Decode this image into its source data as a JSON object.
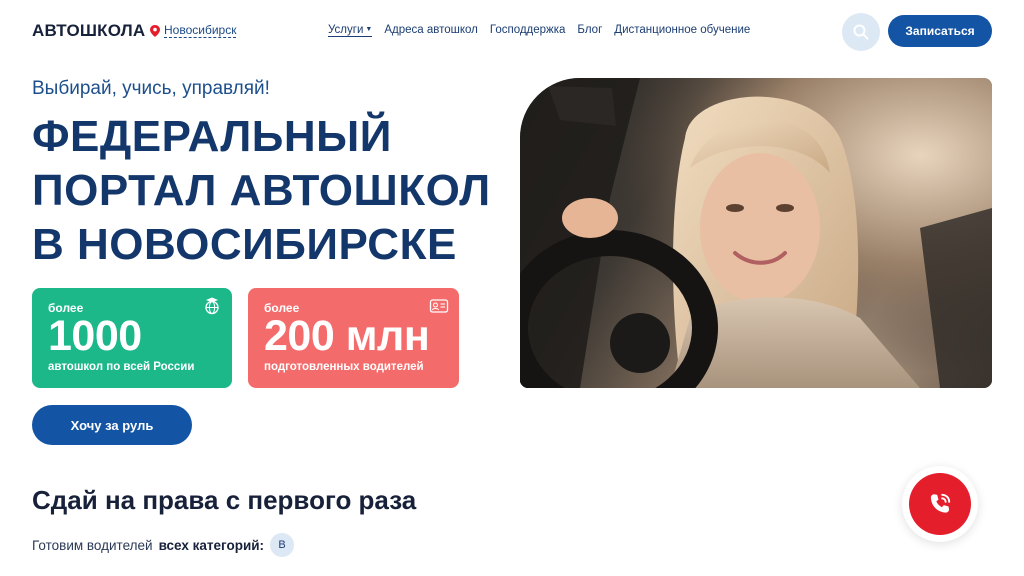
{
  "header": {
    "logo": "АВТОШКОЛА",
    "city": "Новосибирск",
    "nav": [
      {
        "label": "Услуги"
      },
      {
        "label": "Адреса автошкол"
      },
      {
        "label": "Господдержка"
      },
      {
        "label": "Блог"
      },
      {
        "label": "Дистанционное обучение"
      }
    ],
    "signup_label": "Записаться"
  },
  "hero": {
    "slogan": "Выбирай, учись, управляй!",
    "title_lines": [
      "ФЕДЕРАЛЬНЫЙ",
      "ПОРТАЛ АВТОШКОЛ",
      "В НОВОСИБИРСКЕ"
    ],
    "stats": [
      {
        "pre": "более",
        "value": "1000",
        "caption": "автошкол по всей России",
        "color": "#1db88a"
      },
      {
        "pre": "более",
        "value": "200 млн",
        "caption": "подготовленных водителей",
        "color": "#f46b6b"
      }
    ],
    "cta_label": "Хочу за руль"
  },
  "section": {
    "title": "Сдай на права с первого раза",
    "subtitle_prefix": "Готовим водителей",
    "subtitle_bold": "всех категорий:",
    "category": "B"
  },
  "colors": {
    "primary": "#1454a4",
    "heading": "#14376b",
    "call": "#e51e2c"
  },
  "icons": [
    "location-pin-icon",
    "search-icon",
    "graduation-globe-icon",
    "driver-license-icon",
    "phone-icon"
  ]
}
